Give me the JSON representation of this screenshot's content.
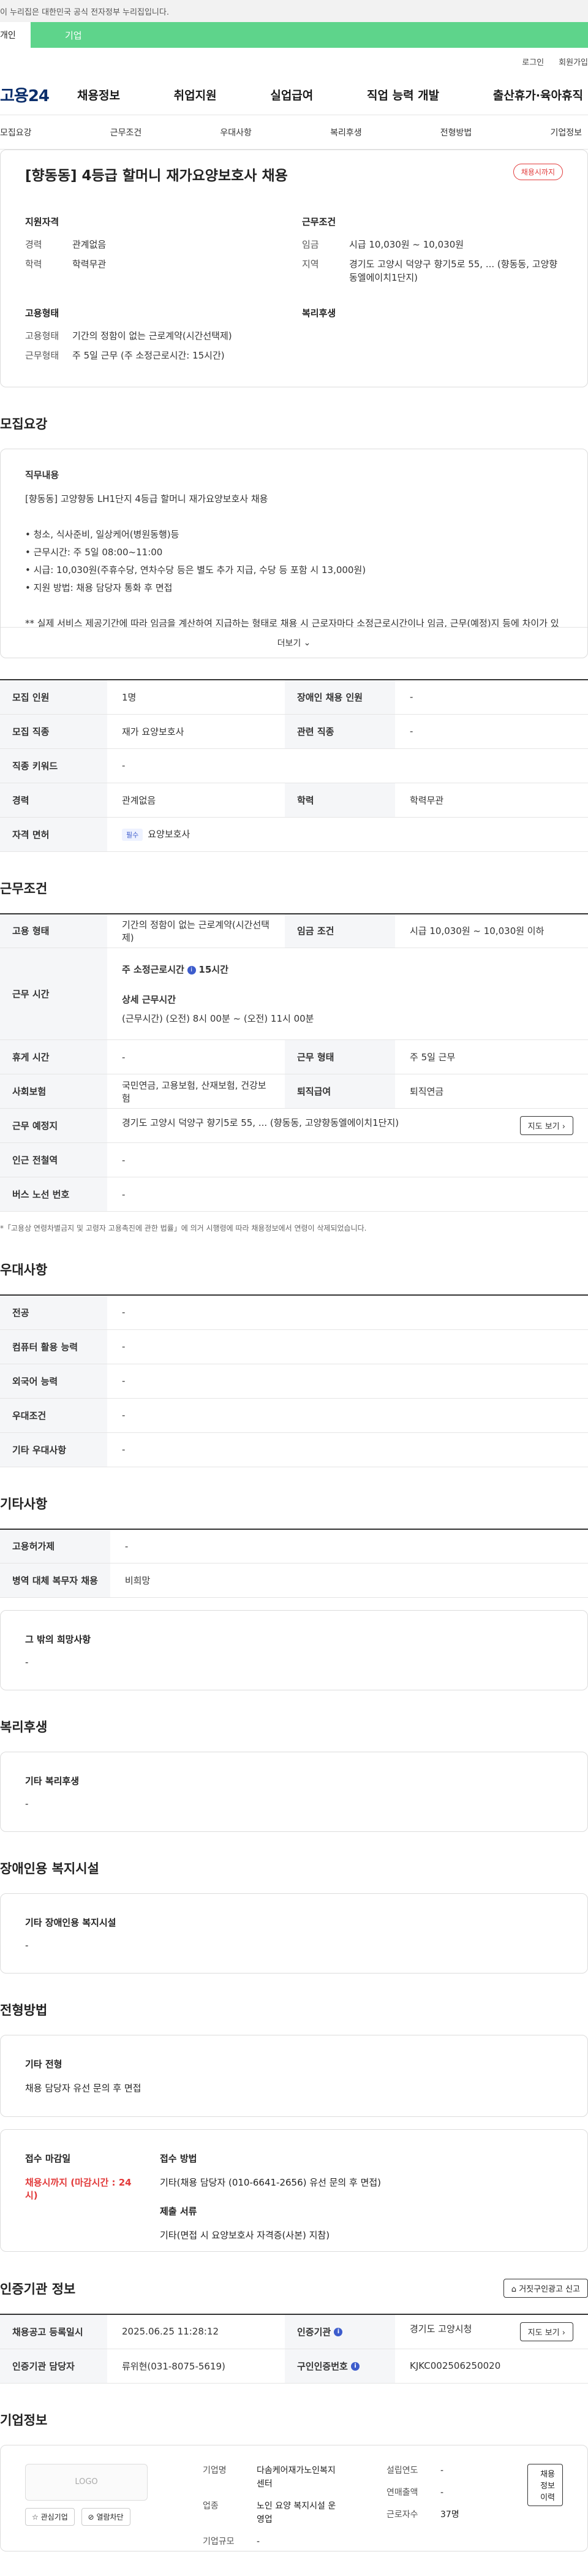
{
  "gov_bar": "이 누리집은 대한민국 공식 전자정부 누리집입니다.",
  "top_tabs": [
    "개인",
    "기업"
  ],
  "util": [
    "로그인",
    "회원가입"
  ],
  "logo": "고용24",
  "gnb": [
    "채용정보",
    "취업지원",
    "실업급여",
    "직업 능력 개발",
    "출산휴가·육아휴직"
  ],
  "subnav": [
    "모집요강",
    "근무조건",
    "우대사항",
    "복리후생",
    "전형방법",
    "기업정보"
  ],
  "summary": {
    "title": "[향동동] 4등급 할머니 재가요양보호사 채용",
    "badge": "채용시까지",
    "qual_h": "지원자격",
    "cond_h": "근무조건",
    "emp_h": "고용형태",
    "wel_h": "복리후생",
    "qual": [
      {
        "k": "경력",
        "v": "관계없음"
      },
      {
        "k": "학력",
        "v": "학력무관"
      }
    ],
    "cond": [
      {
        "k": "임금",
        "v": "시급 10,030원 ~ 10,030원"
      },
      {
        "k": "지역",
        "v": "경기도 고양시 덕양구 향기5로 55, ... (향동동, 고양향동엘에이치1단지)"
      }
    ],
    "emp": [
      {
        "k": "고용형태",
        "v": "기간의 정함이 없는 근로계약(시간선택제)"
      },
      {
        "k": "근무형태",
        "v": "주 5일 근무 (주 소정근로시간: 15시간)"
      }
    ]
  },
  "sec1": "모집요강",
  "desc": {
    "h": "직무내용",
    "lines": [
      "[향동동] 고양향동 LH1단지 4등급 할머니 재가요양보호사 채용",
      "",
      "• 청소, 식사준비, 일상케어(병원동행)등",
      "• 근무시간: 주 5일 08:00~11:00",
      "• 시급: 10,030원(주휴수당, 연차수당 등은 별도 추가 지급, 수당 등 포함 시 13,000원)",
      "• 지원 방법: 채용 담당자 통화 후 면접",
      "",
      "** 실제 서비스 제공기간에 따라 임금을 계산하여 지급하는 형태로 채용 시 근로자마다 소정근로시간이나 임금, 근무(예정)지 등에 차이가 있을 수 있음"
    ],
    "more": "더보기"
  },
  "t1": [
    {
      "th": "모집 인원",
      "td": "1명",
      "th2": "장애인 채용 인원",
      "td2": "-"
    },
    {
      "th": "모집 직종",
      "td": "재가 요양보호사",
      "th2": "관련 직종",
      "td2": "-"
    },
    {
      "th": "직종 키워드",
      "td": "-"
    },
    {
      "th": "경력",
      "td": "관계없음",
      "th2": "학력",
      "td2": "학력무관"
    },
    {
      "th": "자격 면허",
      "pill": "필수",
      "td": "요양보호사"
    }
  ],
  "sec2": "근무조건",
  "t2": {
    "emp_th": "고용 형태",
    "emp_td": "기간의 정함이 없는 근로계약(시간선택제)",
    "wage_th": "임금 조건",
    "wage_td": "시급 10,030원 ~ 10,030원 이하",
    "time_th": "근무 시간",
    "time_l1": "주 소정근로시간",
    "time_l1b": "15시간",
    "time_l2": "상세 근무시간",
    "time_l3": "(근무시간) (오전) 8시 00분 ~ (오전) 11시 00분",
    "rest_th": "휴게 시간",
    "rest_td": "-",
    "form_th": "근무 형태",
    "form_td": "주 5일 근무",
    "ins_th": "사회보험",
    "ins_td": "국민연금, 고용보험, 산재보험, 건강보험",
    "ret_th": "퇴직급여",
    "ret_td": "퇴직연금",
    "place_th": "근무 예정지",
    "place_td": "경기도 고양시 덕양구 향기5로 55, ... (향동동, 고양향동엘에이치1단지)",
    "map": "지도 보기",
    "sub_th": "인근 전철역",
    "sub_td": "-",
    "bus_th": "버스 노선 번호",
    "bus_td": "-"
  },
  "note": "*「고용상 연령차별금지 및 고령자 고용촉진에 관한 법률」에 의거 시행령에 따라 채용정보에서 연령이 삭제되었습니다.",
  "sec3": "우대사항",
  "t3": [
    {
      "th": "전공",
      "td": "-"
    },
    {
      "th": "컴퓨터 활용 능력",
      "td": "-"
    },
    {
      "th": "외국어 능력",
      "td": "-"
    },
    {
      "th": "우대조건",
      "td": "-"
    },
    {
      "th": "기타 우대사항",
      "td": "-"
    }
  ],
  "sec4": "기타사항",
  "t4": [
    {
      "th": "고용허가제",
      "td": "-"
    },
    {
      "th": "병역 대체 복무자 채용",
      "td": "비희망"
    }
  ],
  "etc_box": {
    "h": "그 밖의 희망사항",
    "v": "-"
  },
  "sec5": "복리후생",
  "wel_box": {
    "h": "기타 복리후생",
    "v": "-"
  },
  "sec6": "장애인용 복지시설",
  "dis_box": {
    "h": "기타 장애인용 복지시설",
    "v": "-"
  },
  "sec7": "전형방법",
  "sel_box": {
    "h": "기타 전형",
    "v": "채용 담당자 유선 문의 후 면접"
  },
  "apply": {
    "deadline_h": "접수 마감일",
    "deadline_v": "채용시까지 (마감시간 : 24시)",
    "method_h": "접수 방법",
    "method_v": "기타(채용 담당자 (010-6641-2656) 유선 문의 후 면접)",
    "doc_h": "제출 서류",
    "doc_v": "기타(면접 시 요양보호사 자격증(사본) 지참)"
  },
  "sec8": "인증기관 정보",
  "report": "거짓구인광고 신고",
  "t8": {
    "reg_th": "채용공고 등록일시",
    "reg_td": "2025.06.25 11:28:12",
    "org_th": "인증기관",
    "org_td": "경기도 고양시청",
    "mgr_th": "인증기관 담당자",
    "mgr_td": "류위현(031-8075-5619)",
    "id_th": "구인인증번호",
    "id_td": "KJKC002506250020",
    "map": "지도 보기"
  },
  "sec9": "기업정보",
  "company": {
    "logo": "LOGO",
    "fav": "관심기업",
    "block": "열람차단",
    "name_k": "기업명",
    "name_v": "다솜케어재가노인복지센터",
    "biz_k": "업종",
    "biz_v": "노인 요양 복지시설 운영업",
    "scale_k": "기업규모",
    "scale_v": "-",
    "year_k": "설립연도",
    "year_v": "-",
    "sales_k": "연매출액",
    "sales_v": "-",
    "emp_k": "근로자수",
    "emp_v": "37명",
    "history": "채용정보 이력"
  }
}
